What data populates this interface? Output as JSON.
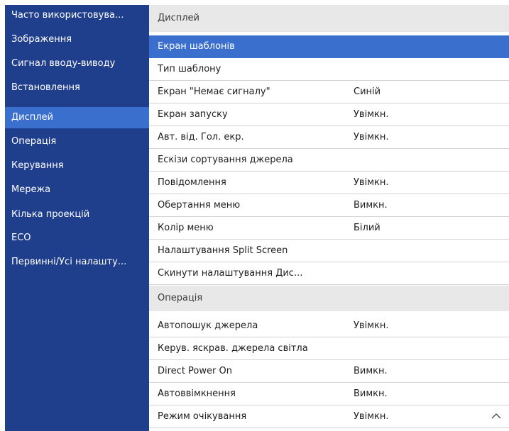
{
  "sidebar": {
    "items": [
      {
        "label": "Часто використовува..."
      },
      {
        "label": "Зображення"
      },
      {
        "label": "Сигнал вводу-виводу"
      },
      {
        "label": "Встановлення"
      },
      {
        "label": "Дисплей"
      },
      {
        "label": "Операція"
      },
      {
        "label": "Керування"
      },
      {
        "label": "Мережа"
      },
      {
        "label": "Кілька проекцій"
      },
      {
        "label": "ECO"
      },
      {
        "label": "Первинні/Усі налашту..."
      }
    ],
    "selected_label": "Дисплей"
  },
  "sections": {
    "display": {
      "header": "Дисплей",
      "rows": [
        {
          "label": "Екран шаблонів",
          "value": ""
        },
        {
          "label": "Тип шаблону",
          "value": ""
        },
        {
          "label": "Екран \"Немає сигналу\"",
          "value": "Синій"
        },
        {
          "label": "Екран запуску",
          "value": "Увімкн."
        },
        {
          "label": "Авт. від. Гол. екр.",
          "value": "Увімкн."
        },
        {
          "label": "Ескізи сортування джерела",
          "value": ""
        },
        {
          "label": "Повідомлення",
          "value": "Увімкн."
        },
        {
          "label": "Обертання меню",
          "value": "Вимкн."
        },
        {
          "label": "Колір меню",
          "value": "Білий"
        },
        {
          "label": "Налаштування Split Screen",
          "value": ""
        },
        {
          "label": "Скинути налаштування Дис...",
          "value": ""
        }
      ],
      "selected_label": "Екран шаблонів"
    },
    "operation": {
      "header": "Операція",
      "rows": [
        {
          "label": "Автопошук джерела",
          "value": "Увімкн."
        },
        {
          "label": "Керув. яскрав. джерела світла",
          "value": ""
        },
        {
          "label": "Direct Power On",
          "value": "Вимкн."
        },
        {
          "label": "Автоввімкнення",
          "value": "Вимкн."
        },
        {
          "label": "Режим очікування",
          "value": "Увімкн."
        }
      ]
    }
  },
  "icons": {
    "scroll_up": "chevron-up-icon"
  },
  "colors": {
    "sidebar_bg": "#1f3e8c",
    "selection": "#3b6fcd",
    "section_header_bg": "#e8e8e8"
  }
}
